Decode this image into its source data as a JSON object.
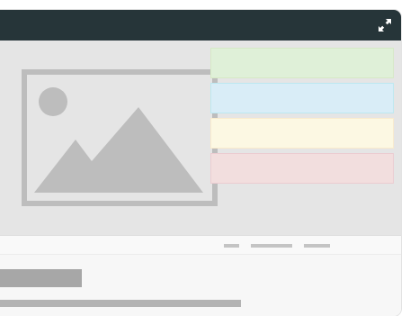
{
  "window": {
    "titlebar": {
      "expand_icon": "expand-arrows-icon"
    },
    "media": {
      "icon": "image-placeholder-icon"
    },
    "swatches": [
      {
        "name": "green",
        "fill": "#dff0d8",
        "border": "#d6e9c6"
      },
      {
        "name": "blue",
        "fill": "#d9edf7",
        "border": "#bce8f1"
      },
      {
        "name": "yellow",
        "fill": "#fcf8e3",
        "border": "#faebcc"
      },
      {
        "name": "red",
        "fill": "#f2dede",
        "border": "#ebccd1"
      }
    ],
    "colors": {
      "titlebar": "#263539",
      "canvas": "#e5e5e5",
      "placeholder_gray": "#bdbdbd"
    }
  }
}
